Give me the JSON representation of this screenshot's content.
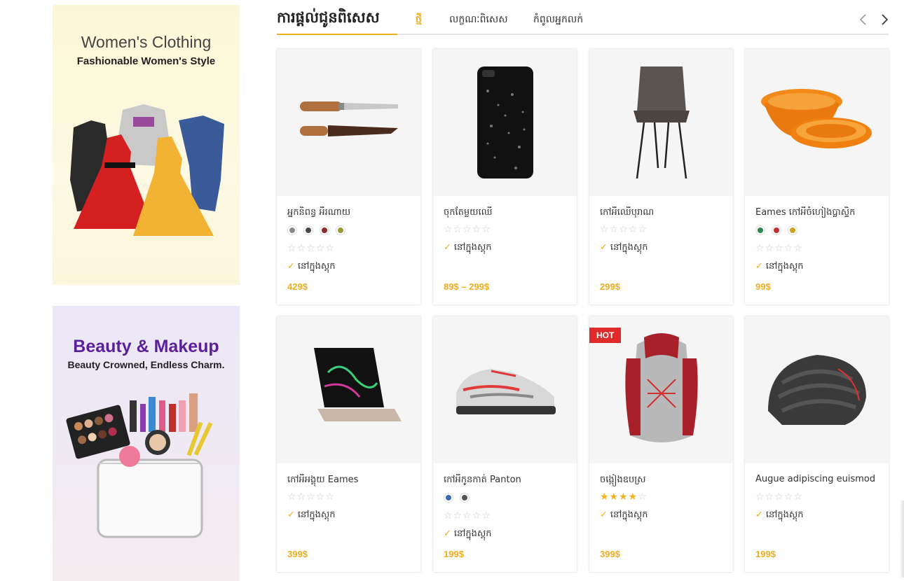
{
  "banners": [
    {
      "title": "Women's Clothing",
      "subtitle": "Fashionable Women's Style"
    },
    {
      "title": "Beauty & Makeup",
      "subtitle": "Beauty Crowned, Endless Charm."
    }
  ],
  "section": {
    "title": "ការផ្តល់ជូនពិសេស",
    "tabs": [
      {
        "label": "ថ្មី",
        "active": true
      },
      {
        "label": "លក្ខណៈពិសេស",
        "active": false
      },
      {
        "label": "កំពូលអ្នកលក់",
        "active": false
      }
    ],
    "prev_icon": "chevron-left-icon",
    "next_icon": "chevron-right-icon"
  },
  "colors": {
    "accent": "#f0ad1e",
    "hot": "#e02b2b",
    "star": "#f0b51e"
  },
  "products": [
    {
      "name": "អ្នកនិពន្ធ អីរណាយ",
      "swatches": [
        "#8a8a8a",
        "#4a4a4a",
        "#8e2a2a",
        "#9a9a3a"
      ],
      "rating": 0,
      "stock": "នៅក្នុងស្តុក",
      "price": "429$",
      "hot": false
    },
    {
      "name": "ចុកតែម្លយឈើ",
      "swatches": [],
      "rating": 0,
      "stock": "នៅក្នុងស្តុក",
      "price": "89$ – 299$",
      "hot": false
    },
    {
      "name": "កៅអីឈើបុរាណ",
      "swatches": [],
      "rating": 0,
      "stock": "នៅក្នុងស្តុក",
      "price": "299$",
      "hot": false
    },
    {
      "name": "Eames កៅអីចំហៀងប្លាស្ទិក",
      "swatches": [
        "#2a8a4a",
        "#c03030",
        "#d0a020"
      ],
      "rating": 0,
      "stock": "នៅក្នុងស្តុក",
      "price": "99$",
      "hot": false
    },
    {
      "name": "កៅអីអង្គុយ Eames",
      "swatches": [],
      "rating": 0,
      "stock": "នៅក្នុងស្តុក",
      "price": "399$",
      "hot": false
    },
    {
      "name": "កៅអីកូនកាត់ Panton",
      "swatches": [
        "#3a6ab0",
        "#555555"
      ],
      "rating": 0,
      "stock": "នៅក្នុងស្តុក",
      "price": "199$",
      "hot": false
    },
    {
      "name": "ចង្កៀងឧបស្រ",
      "swatches": [],
      "rating": 4,
      "stock": "នៅក្នុងស្តុក",
      "price": "399$",
      "hot": true,
      "badge": "HOT"
    },
    {
      "name": "Augue adipiscing euismod",
      "swatches": [],
      "rating": 0,
      "stock": "នៅក្នុងស្តុក",
      "price": "199$",
      "hot": false
    }
  ]
}
